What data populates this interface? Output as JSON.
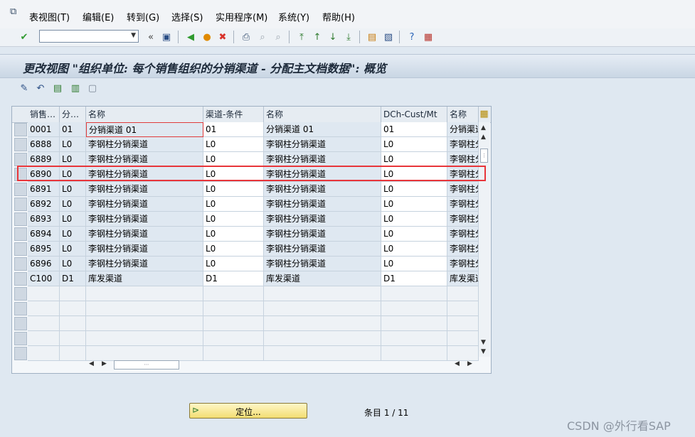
{
  "menu": {
    "items": [
      "表视图(T)",
      "编辑(E)",
      "转到(G)",
      "选择(S)",
      "实用程序(M)",
      "系统(Y)",
      "帮助(H)"
    ]
  },
  "toolbar": {
    "command_value": "",
    "icons": [
      "check-icon",
      "save-icon",
      "back-icon",
      "exit-icon",
      "cancel-icon",
      "print-icon",
      "find-icon",
      "find-next-icon",
      "first-page-icon",
      "previous-page-icon",
      "next-page-icon",
      "last-page-icon",
      "create-session-icon",
      "shortcut-icon",
      "help-icon",
      "customize-layout-icon"
    ]
  },
  "title": "更改视图 \"组织单位: 每个销售组织的分销渠道 - 分配主文档数据\": 概览",
  "table": {
    "headers": [
      "销售…",
      "分…",
      "名称",
      "渠道-条件",
      "名称",
      "DCh-Cust/Mt",
      "名称"
    ],
    "rows": [
      [
        "0001",
        "01",
        "分销渠道 01",
        "01",
        "分销渠道 01",
        "01",
        "分销渠道"
      ],
      [
        "6888",
        "L0",
        "李钢柱分销渠道",
        "L0",
        "李钢柱分销渠道",
        "L0",
        "李钢柱分"
      ],
      [
        "6889",
        "L0",
        "李钢柱分销渠道",
        "L0",
        "李钢柱分销渠道",
        "L0",
        "李钢柱分"
      ],
      [
        "6890",
        "L0",
        "李钢柱分销渠道",
        "L0",
        "李钢柱分销渠道",
        "L0",
        "李钢柱分"
      ],
      [
        "6891",
        "L0",
        "李钢柱分销渠道",
        "L0",
        "李钢柱分销渠道",
        "L0",
        "李钢柱分"
      ],
      [
        "6892",
        "L0",
        "李钢柱分销渠道",
        "L0",
        "李钢柱分销渠道",
        "L0",
        "李钢柱分"
      ],
      [
        "6893",
        "L0",
        "李钢柱分销渠道",
        "L0",
        "李钢柱分销渠道",
        "L0",
        "李钢柱分"
      ],
      [
        "6894",
        "L0",
        "李钢柱分销渠道",
        "L0",
        "李钢柱分销渠道",
        "L0",
        "李钢柱分"
      ],
      [
        "6895",
        "L0",
        "李钢柱分销渠道",
        "L0",
        "李钢柱分销渠道",
        "L0",
        "李钢柱分"
      ],
      [
        "6896",
        "L0",
        "李钢柱分销渠道",
        "L0",
        "李钢柱分销渠道",
        "L0",
        "李钢柱分"
      ],
      [
        "C100",
        "D1",
        "库发渠道",
        "D1",
        "库发渠道",
        "D1",
        "库发渠道"
      ]
    ],
    "empty_rows": 5,
    "highlighted_row": 3
  },
  "footer": {
    "position_button": "定位...",
    "entry_count": "条目 1 / 11"
  },
  "watermark": "CSDN @外行看SAP",
  "colors": {
    "highlight": "#e8353a",
    "position_button": "#f5e38c"
  }
}
